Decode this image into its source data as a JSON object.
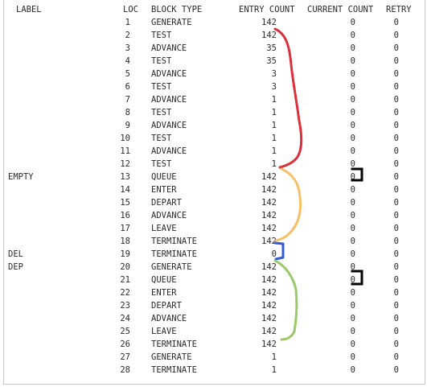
{
  "headers": {
    "label": "LABEL",
    "loc": "LOC",
    "block_type": "BLOCK TYPE",
    "entry_count": "ENTRY COUNT",
    "current_count": "CURRENT COUNT",
    "retry": "RETRY"
  },
  "rows": [
    {
      "label": "",
      "loc": "1",
      "type": "GENERATE",
      "entry": "142",
      "current": "0",
      "retry": "0"
    },
    {
      "label": "",
      "loc": "2",
      "type": "TEST",
      "entry": "142",
      "current": "0",
      "retry": "0"
    },
    {
      "label": "",
      "loc": "3",
      "type": "ADVANCE",
      "entry": "35",
      "current": "0",
      "retry": "0"
    },
    {
      "label": "",
      "loc": "4",
      "type": "TEST",
      "entry": "35",
      "current": "0",
      "retry": "0"
    },
    {
      "label": "",
      "loc": "5",
      "type": "ADVANCE",
      "entry": "3",
      "current": "0",
      "retry": "0"
    },
    {
      "label": "",
      "loc": "6",
      "type": "TEST",
      "entry": "3",
      "current": "0",
      "retry": "0"
    },
    {
      "label": "",
      "loc": "7",
      "type": "ADVANCE",
      "entry": "1",
      "current": "0",
      "retry": "0"
    },
    {
      "label": "",
      "loc": "8",
      "type": "TEST",
      "entry": "1",
      "current": "0",
      "retry": "0"
    },
    {
      "label": "",
      "loc": "9",
      "type": "ADVANCE",
      "entry": "1",
      "current": "0",
      "retry": "0"
    },
    {
      "label": "",
      "loc": "10",
      "type": "TEST",
      "entry": "1",
      "current": "0",
      "retry": "0"
    },
    {
      "label": "",
      "loc": "11",
      "type": "ADVANCE",
      "entry": "1",
      "current": "0",
      "retry": "0"
    },
    {
      "label": "",
      "loc": "12",
      "type": "TEST",
      "entry": "1",
      "current": "0",
      "retry": "0"
    },
    {
      "label": "EMPTY",
      "loc": "13",
      "type": "QUEUE",
      "entry": "142",
      "current": "0",
      "retry": "0"
    },
    {
      "label": "",
      "loc": "14",
      "type": "ENTER",
      "entry": "142",
      "current": "0",
      "retry": "0"
    },
    {
      "label": "",
      "loc": "15",
      "type": "DEPART",
      "entry": "142",
      "current": "0",
      "retry": "0"
    },
    {
      "label": "",
      "loc": "16",
      "type": "ADVANCE",
      "entry": "142",
      "current": "0",
      "retry": "0"
    },
    {
      "label": "",
      "loc": "17",
      "type": "LEAVE",
      "entry": "142",
      "current": "0",
      "retry": "0"
    },
    {
      "label": "",
      "loc": "18",
      "type": "TERMINATE",
      "entry": "142",
      "current": "0",
      "retry": "0"
    },
    {
      "label": "DEL",
      "loc": "19",
      "type": "TERMINATE",
      "entry": "0",
      "current": "0",
      "retry": "0"
    },
    {
      "label": "DEP",
      "loc": "20",
      "type": "GENERATE",
      "entry": "142",
      "current": "0",
      "retry": "0"
    },
    {
      "label": "",
      "loc": "21",
      "type": "QUEUE",
      "entry": "142",
      "current": "0",
      "retry": "0"
    },
    {
      "label": "",
      "loc": "22",
      "type": "ENTER",
      "entry": "142",
      "current": "0",
      "retry": "0"
    },
    {
      "label": "",
      "loc": "23",
      "type": "DEPART",
      "entry": "142",
      "current": "0",
      "retry": "0"
    },
    {
      "label": "",
      "loc": "24",
      "type": "ADVANCE",
      "entry": "142",
      "current": "0",
      "retry": "0"
    },
    {
      "label": "",
      "loc": "25",
      "type": "LEAVE",
      "entry": "142",
      "current": "0",
      "retry": "0"
    },
    {
      "label": "",
      "loc": "26",
      "type": "TERMINATE",
      "entry": "142",
      "current": "0",
      "retry": "0"
    },
    {
      "label": "",
      "loc": "27",
      "type": "GENERATE",
      "entry": "1",
      "current": "0",
      "retry": "0"
    },
    {
      "label": "",
      "loc": "28",
      "type": "TERMINATE",
      "entry": "1",
      "current": "0",
      "retry": "0"
    }
  ],
  "annotation_colors": {
    "red": "#d9303a",
    "yellow": "#f5c065",
    "blue": "#2f5bd8",
    "green": "#9bc86a",
    "black": "#000000"
  }
}
